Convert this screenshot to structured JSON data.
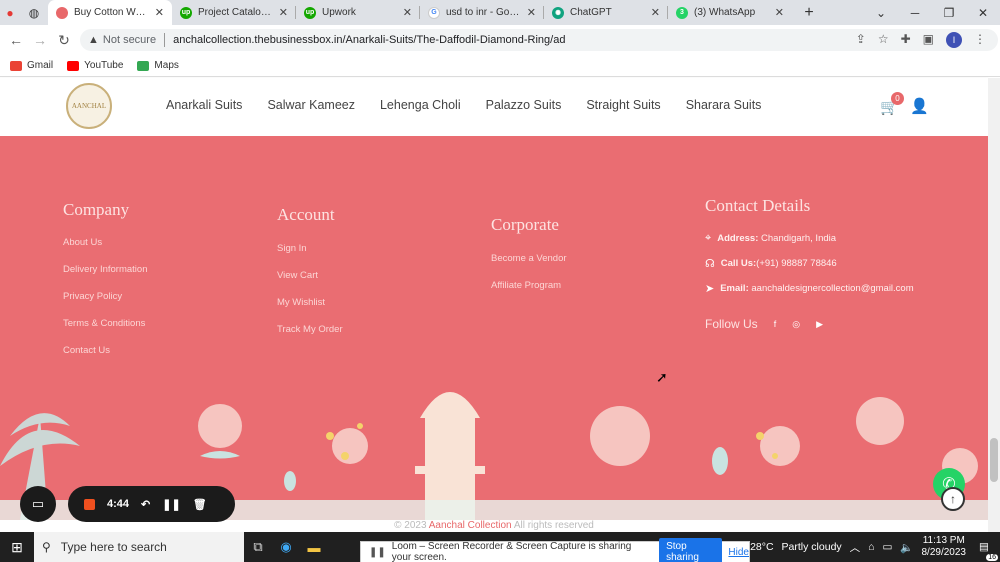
{
  "browser": {
    "tabs": [
      {
        "title": "Buy Cotton Women",
        "fav_color": "#e8686a",
        "active": true
      },
      {
        "title": "Project Catalog | Up",
        "fav_color": "#14a800",
        "active": false
      },
      {
        "title": "Upwork",
        "fav_color": "#14a800",
        "active": false
      },
      {
        "title": "usd to inr - Google",
        "fav_color": "#4285f4",
        "active": false
      },
      {
        "title": "ChatGPT",
        "fav_color": "#10a37f",
        "active": false
      },
      {
        "title": "(3) WhatsApp",
        "fav_color": "#25d366",
        "active": false
      }
    ],
    "new_tab": "+",
    "security": "Not secure",
    "url": "anchalcollection.thebusinessbox.in/Anarkali-Suits/The-Daffodil-Diamond-Ring/ad",
    "bookmarks": [
      {
        "label": "Gmail",
        "color": "#ea4335"
      },
      {
        "label": "YouTube",
        "color": "#ff0000"
      },
      {
        "label": "Maps",
        "color": "#34a853"
      }
    ],
    "profile_initial": "I"
  },
  "site": {
    "logo_text": "AANCHAL",
    "nav": [
      "Anarkali Suits",
      "Salwar Kameez",
      "Lehenga Choli",
      "Palazzo Suits",
      "Straight Suits",
      "Sharara Suits"
    ],
    "cart_count": "0"
  },
  "footer": {
    "company": {
      "title": "Company",
      "links": [
        "About Us",
        "Delivery Information",
        "Privacy Policy",
        "Terms & Conditions",
        "Contact Us"
      ]
    },
    "account": {
      "title": "Account",
      "links": [
        "Sign In",
        "View Cart",
        "My Wishlist",
        "Track My Order"
      ]
    },
    "corporate": {
      "title": "Corporate",
      "links": [
        "Become a Vendor",
        "Affiliate Program"
      ]
    },
    "contact": {
      "title": "Contact Details",
      "address_label": "Address:",
      "address": "Chandigarh, India",
      "call_label": "Call Us:",
      "call": "(+91) 98887 78846",
      "email_label": "Email:",
      "email": "aanchaldesignercollection@gmail.com",
      "follow": "Follow Us"
    },
    "copyright_prefix": "© 2023",
    "copyright_brand": "Aanchal Collection",
    "copyright_suffix": "All rights reserved"
  },
  "loom": {
    "time": "4:44",
    "share_message": "Loom – Screen Recorder & Screen Capture is sharing your screen.",
    "stop_label": "Stop sharing",
    "hide_label": "Hide"
  },
  "taskbar": {
    "search_placeholder": "Type here to search",
    "weather_temp": "28°C",
    "weather_desc": "Partly cloudy",
    "time": "11:13 PM",
    "date": "8/29/2023",
    "notif_count": "16"
  },
  "colors": {
    "footer_bg": "#ea6d72",
    "accent": "#e8686a"
  }
}
